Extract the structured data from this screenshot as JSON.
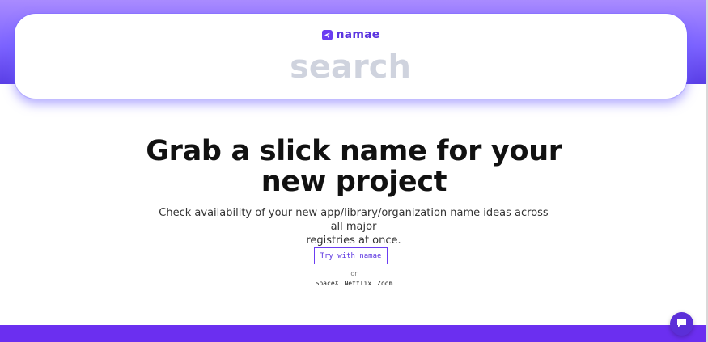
{
  "brand": {
    "name": "namae",
    "logo_icon": "paper-plane-icon",
    "color": "#5b34e0"
  },
  "search": {
    "placeholder": "search"
  },
  "hero": {
    "headline_line1": "Grab a slick name for your",
    "headline_line2": "new project",
    "subtitle_line1": "Check availability of your new app/library/organization name ideas across all major",
    "subtitle_line2": "registries at once."
  },
  "cta": {
    "try_label": "Try with namae",
    "or_label": "or",
    "examples": [
      "SpaceX",
      "Netflix",
      "Zoom"
    ]
  },
  "chat": {
    "icon": "chat-bubble-icon"
  },
  "colors": {
    "accent": "#6b3df2",
    "gradient_top": "#a98bff",
    "gradient_bottom": "#5a3fe6",
    "footer": "#6b2ff0"
  }
}
